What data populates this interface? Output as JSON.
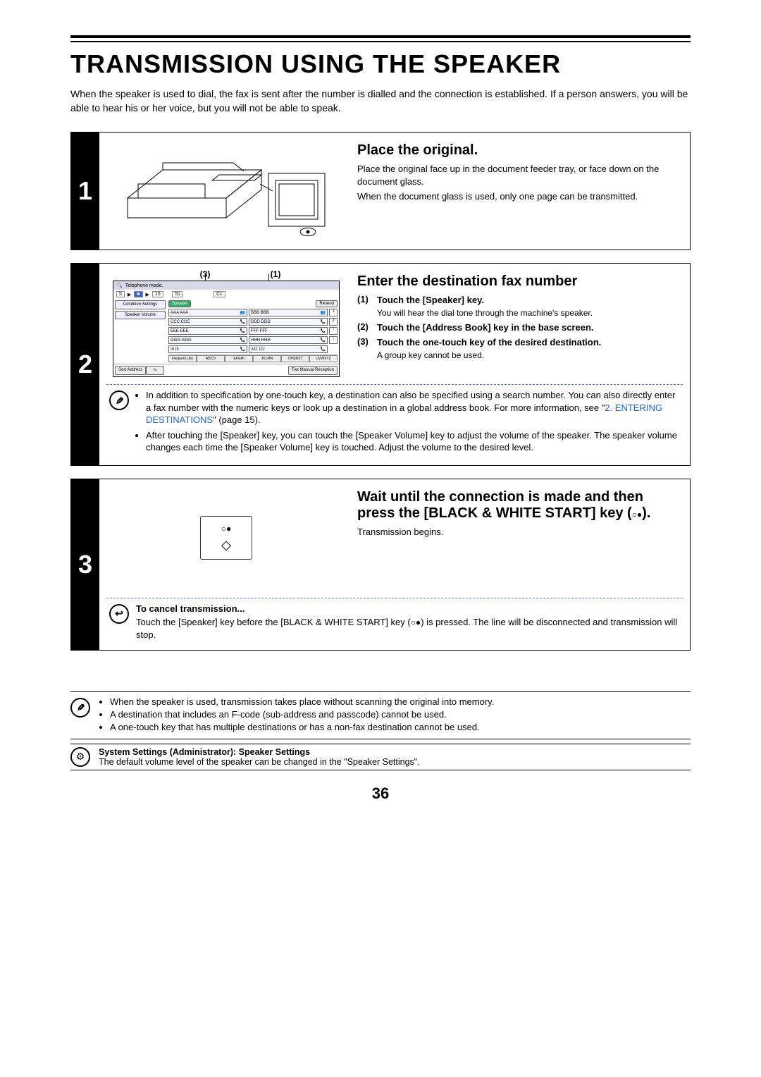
{
  "page_number": "36",
  "title": "TRANSMISSION USING THE SPEAKER",
  "intro": "When the speaker is used to dial, the fax is sent after the number is dialled and the connection is established. If a person answers, you will be able to hear his or her voice, but you will not be able to speak.",
  "steps": [
    {
      "num": "1",
      "heading": "Place the original.",
      "paragraphs": [
        "Place the original face up in the document feeder tray, or face down on the document glass.",
        "When the document glass is used, only one page can be transmitted."
      ]
    },
    {
      "num": "2",
      "heading": "Enter the destination fax number",
      "callout_left": "(3)",
      "callout_right": "(1)",
      "substeps": [
        {
          "n": "(1)",
          "title": "Touch the [Speaker] key.",
          "note": "You will hear the dial tone through the machine's speaker."
        },
        {
          "n": "(2)",
          "title": "Touch the [Address Book] key in the base screen.",
          "note": ""
        },
        {
          "n": "(3)",
          "title": "Touch the one-touch key of the desired destination.",
          "note": "A group key cannot be used."
        }
      ],
      "note_bullets": [
        "In addition to specification by one-touch key, a destination can also be specified using a search number. You can also directly enter a fax number with the numeric keys or look up a destination in a global address book. For more information, see \"",
        "After touching the [Speaker] key, you can touch the [Speaker Volume] key to adjust the volume of the speaker. The speaker volume changes each time the [Speaker Volume] key is touched. Adjust the volume to the desired level."
      ],
      "note_link_text": "2. ENTERING DESTINATIONS",
      "note_link_tail": "\" (page 15).",
      "screen": {
        "mode_label": "Telephone mode.",
        "tabs_left": [
          "5",
          "15"
        ],
        "to_label": "To",
        "cc_label": "Cc",
        "left_buttons": [
          "Condition Settings",
          "Speaker Volume"
        ],
        "top_buttons": {
          "speaker": "Speaker",
          "resend": "Resend"
        },
        "one_touch": [
          [
            "AAA AAA",
            "BBB BBB"
          ],
          [
            "CCC CCC",
            "DDD DDD"
          ],
          [
            "EEE EEE",
            "FFF FFF"
          ],
          [
            "GGG GGG",
            "HHH HHH"
          ],
          [
            "III III",
            "JJJ JJJ"
          ]
        ],
        "pagers": [
          "1",
          "2",
          "↑",
          "↓"
        ],
        "index_tabs": [
          "Frequent Use",
          "ABCD",
          "EFGHI",
          "JKLMN",
          "OPQRST",
          "UVWXYZ"
        ],
        "bottom_left": "Sort Address",
        "bottom_right": "Fax Manual Reception"
      }
    },
    {
      "num": "3",
      "heading_pre": "Wait until the connection is made and then press the [BLACK & WHITE START] key (",
      "heading_post": ").",
      "paragraphs": [
        "Transmission begins."
      ],
      "cancel_heading": "To cancel transmission...",
      "cancel_text_pre": "Touch the [Speaker] key before the [BLACK & WHITE START] key (",
      "cancel_text_post": ") is pressed. The line will be disconnected and transmission will stop."
    }
  ],
  "lower_notes": [
    "When the speaker is used, transmission takes place without scanning the original into memory.",
    "A destination that includes an F-code (sub-address and passcode) cannot be used.",
    "A one-touch key that has multiple destinations or has a non-fax destination cannot be used."
  ],
  "sys_heading": "System Settings (Administrator): Speaker Settings",
  "sys_text": "The default volume level of the speaker can be changed in the \"Speaker Settings\"."
}
